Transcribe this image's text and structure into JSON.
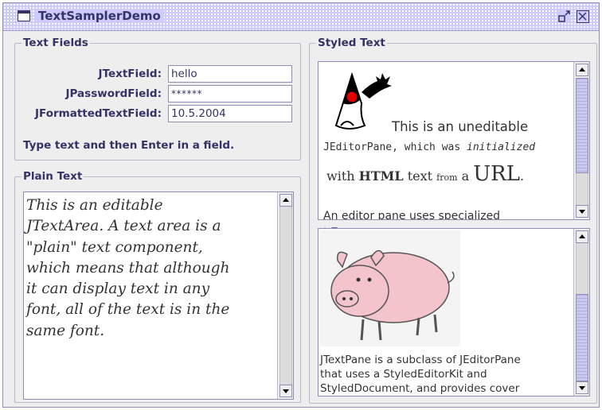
{
  "window": {
    "title": "TextSamplerDemo",
    "controls": {
      "restore_icon": "restore-icon",
      "close_icon": "close-icon"
    }
  },
  "text_fields": {
    "title": "Text Fields",
    "fields": [
      {
        "label": "JTextField:",
        "value": "hello"
      },
      {
        "label": "JPasswordField:",
        "value": "******"
      },
      {
        "label": "JFormattedTextField:",
        "value": "10.5.2004"
      }
    ],
    "hint": "Type text and then Enter in a field."
  },
  "plain_text": {
    "title": "Plain Text",
    "lines": [
      "This is an editable",
      "JTextArea. A text area is a",
      "\"plain\" text component,",
      "which means that although",
      "it can display text in any",
      "font, all of the text is in the",
      "same font."
    ]
  },
  "styled_text": {
    "title": "Styled Text",
    "editor_pane": {
      "image_icon": "duke-mascot-icon",
      "line1": "This is an uneditable",
      "line2_prefix": "JEditorPane, which was ",
      "line2_italic": "initialized",
      "line3_with": "with ",
      "line3_html": "HTML",
      "line3_text": " text ",
      "line3_from": "from",
      "line3_a": " a ",
      "line3_url": "URL",
      "line3_end": ".",
      "line4_partial": "An editor pane uses specialized"
    },
    "text_pane": {
      "image_icon": "pig-icon",
      "lines": [
        "JTextPane is a subclass of JEditorPane",
        "that uses a StyledEditorKit and",
        "StyledDocument, and provides cover"
      ]
    }
  },
  "colors": {
    "window_background": "#eeeeee",
    "titlebar": "#ccccff",
    "label_text": "#333366",
    "border": "#8e8eb3",
    "scroll_thumb": "#c8c8ef"
  }
}
